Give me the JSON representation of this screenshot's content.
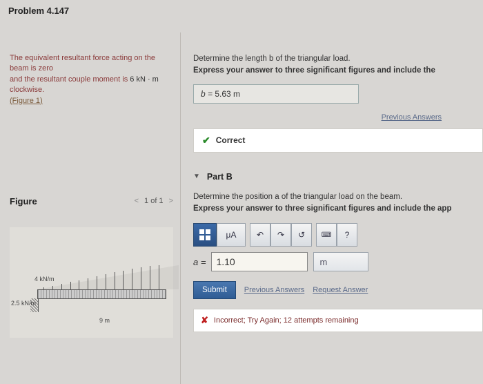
{
  "header": {
    "title": "Problem 4.147"
  },
  "intro": {
    "line1a": "The equivalent resultant force acting on the beam is zero",
    "line1b": "and the resultant couple moment is ",
    "moment": "6  kN · m",
    "dir": " clockwise.",
    "figure_link": "(Figure 1)"
  },
  "figure": {
    "label": "Figure",
    "nav": {
      "prev": "<",
      "pos": "1 of 1",
      "next": ">"
    },
    "load_top": "4 kN/m",
    "load_left": "2.5 kN/m",
    "span": "9 m"
  },
  "partA": {
    "prompt": "Determine the length b of the triangular load.",
    "instruct": "Express your answer to three significant figures and include the",
    "answer_var": "b = ",
    "answer_val": "5.63 m",
    "prev": "Previous Answers",
    "correct": "Correct"
  },
  "partB": {
    "label": "Part B",
    "prompt": "Determine the position a of the triangular load on the beam.",
    "instruct": "Express your answer to three significant figures and include the app",
    "toolbar": {
      "mu": "μΑ",
      "undo": "↶",
      "redo": "↷",
      "reset": "↺",
      "kbd": "⌨",
      "help": "?"
    },
    "var": "a = ",
    "value": "1.10",
    "unit": "m",
    "submit": "Submit",
    "prev": "Previous Answers",
    "req": "Request Answer",
    "feedback": "Incorrect; Try Again; 12 attempts remaining"
  }
}
